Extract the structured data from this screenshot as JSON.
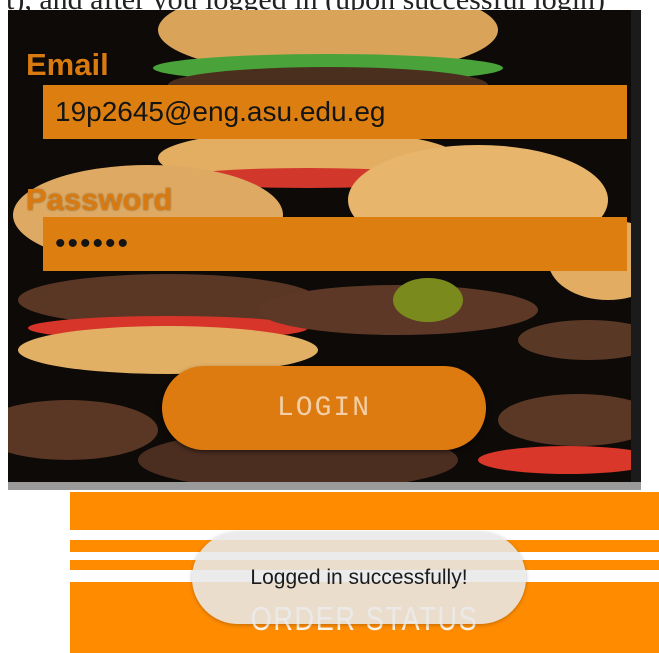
{
  "caption": {
    "text": "t), and after you logged in (upon successful login)"
  },
  "login_screen": {
    "email_label": "Email",
    "email_value": "19p2645@eng.asu.edu.eg",
    "password_label": "Password",
    "password_value": "••••••",
    "login_button": "LOGIN"
  },
  "order_panel": {
    "button_label": "ORDER STATUS"
  },
  "toast": {
    "message": "Logged in successfully!"
  },
  "colors": {
    "accent_orange": "#dd7f10",
    "panel_orange": "#ff8c00",
    "field_text": "#141414",
    "toast_bg": "#e8e8e8"
  }
}
